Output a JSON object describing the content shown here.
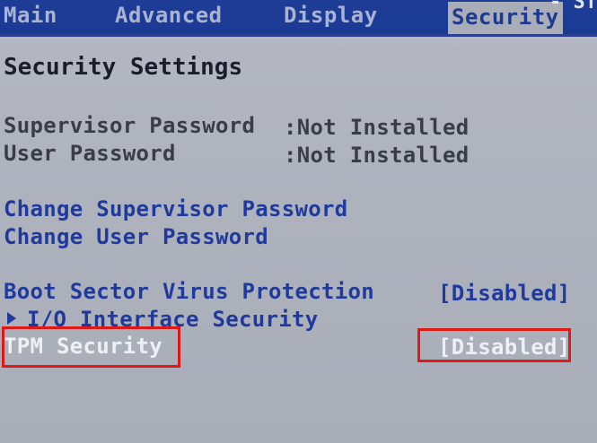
{
  "menu": {
    "tabs": [
      {
        "label": "Main"
      },
      {
        "label": "Advanced"
      },
      {
        "label": "Display"
      },
      {
        "label": "Security"
      }
    ],
    "partial_fragment": "- ST"
  },
  "panel": {
    "title": "Security Settings",
    "supervisor_password": {
      "label": "Supervisor Password",
      "value": ":Not Installed"
    },
    "user_password": {
      "label": "User Password",
      "value": ":Not Installed"
    },
    "change_supervisor": {
      "label": "Change Supervisor Password"
    },
    "change_user": {
      "label": "Change User Password"
    },
    "boot_sector": {
      "label": "Boot Sector Virus Protection",
      "value": "[Disabled]"
    },
    "io_interface": {
      "label": "I/O Interface Security"
    },
    "tpm_security": {
      "label": "TPM Security",
      "value": "[Disabled]"
    }
  },
  "colors": {
    "menu_bg": "#1e3d96",
    "panel_bg": "#aeb2bd",
    "highlight_border": "#e01818",
    "selected_text": "#eef0f6",
    "link_blue": "#1f3a9c"
  }
}
